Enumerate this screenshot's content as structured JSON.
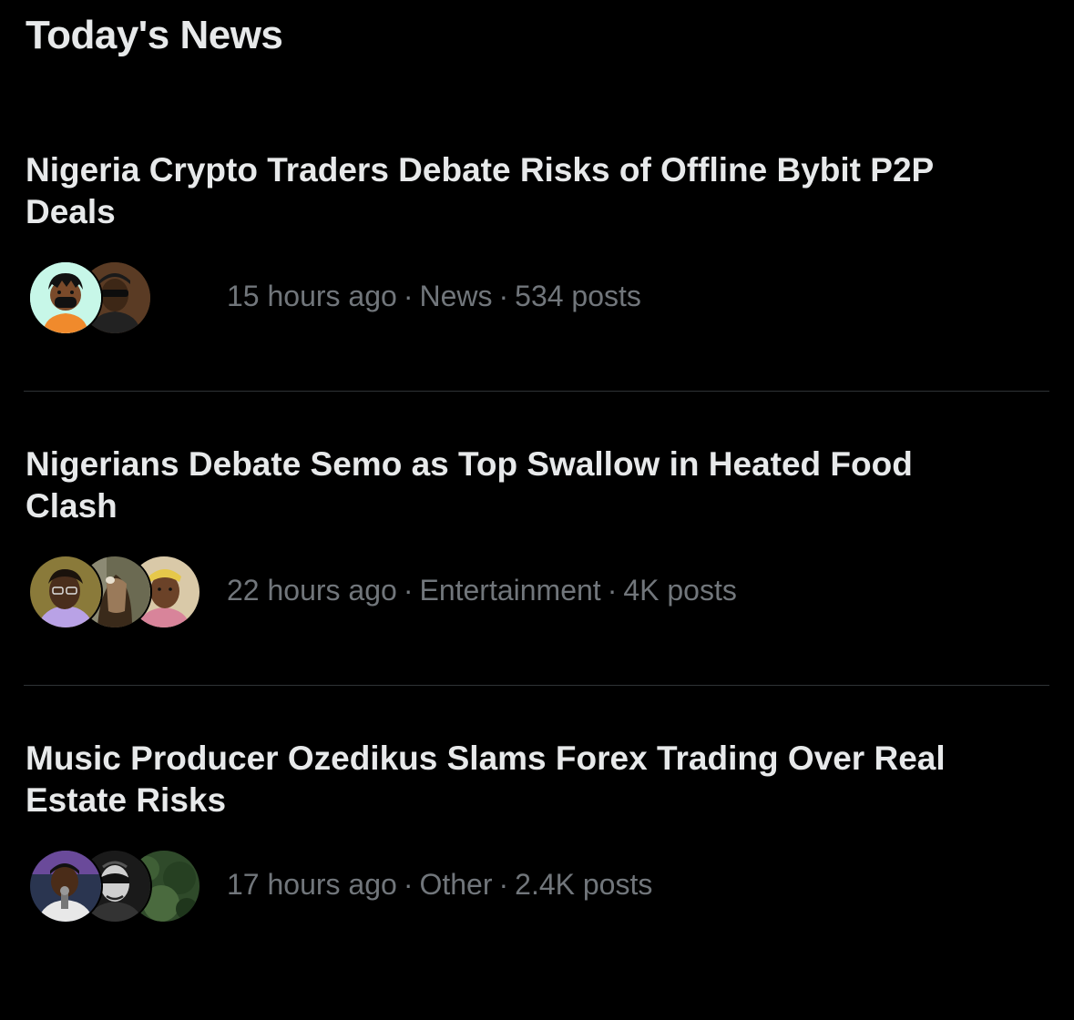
{
  "section": {
    "title": "Today's News"
  },
  "items": [
    {
      "headline": "Nigeria Crypto Traders Debate Risks of Offline Bybit P2P Deals",
      "time": "15 hours ago",
      "category": "News",
      "posts": "534 posts"
    },
    {
      "headline": "Nigerians Debate Semo as Top Swallow in Heated Food Clash",
      "time": "22 hours ago",
      "category": "Entertainment",
      "posts": "4K posts"
    },
    {
      "headline": "Music Producer Ozedikus Slams Forex Trading Over Real Estate Risks",
      "time": "17 hours ago",
      "category": "Other",
      "posts": "2.4K posts"
    }
  ],
  "separator": "·",
  "colors": {
    "background": "#000000",
    "headline": "#e7e9ea",
    "meta": "#71767b",
    "divider": "#2f3336"
  }
}
